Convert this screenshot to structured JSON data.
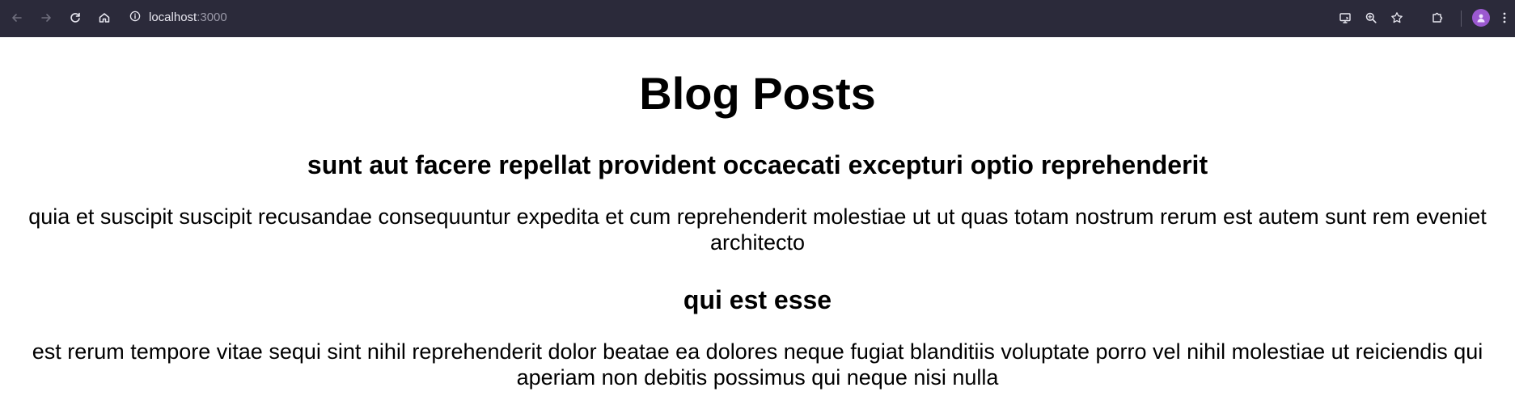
{
  "browser": {
    "address": {
      "host": "localhost",
      "port": ":3000"
    },
    "icons": {
      "back": "back-arrow-icon",
      "forward": "forward-arrow-icon",
      "reload": "reload-icon",
      "home": "home-icon",
      "site_info": "info-icon",
      "cast": "cast-icon",
      "zoom": "zoom-icon",
      "bookmark": "star-icon",
      "extensions": "puzzle-icon",
      "profile": "avatar",
      "menu": "kebab-menu-icon"
    },
    "colors": {
      "toolbar_bg": "#2b2a3a",
      "avatar": "#9b59d0"
    }
  },
  "page": {
    "title": "Blog Posts",
    "posts": [
      {
        "title": "sunt aut facere repellat provident occaecati excepturi optio reprehenderit",
        "body": "quia et suscipit suscipit recusandae consequuntur expedita et cum reprehenderit molestiae ut ut quas totam nostrum rerum est autem sunt rem eveniet architecto"
      },
      {
        "title": "qui est esse",
        "body": "est rerum tempore vitae sequi sint nihil reprehenderit dolor beatae ea dolores neque fugiat blanditiis voluptate porro vel nihil molestiae ut reiciendis qui aperiam non debitis possimus qui neque nisi nulla"
      }
    ]
  }
}
